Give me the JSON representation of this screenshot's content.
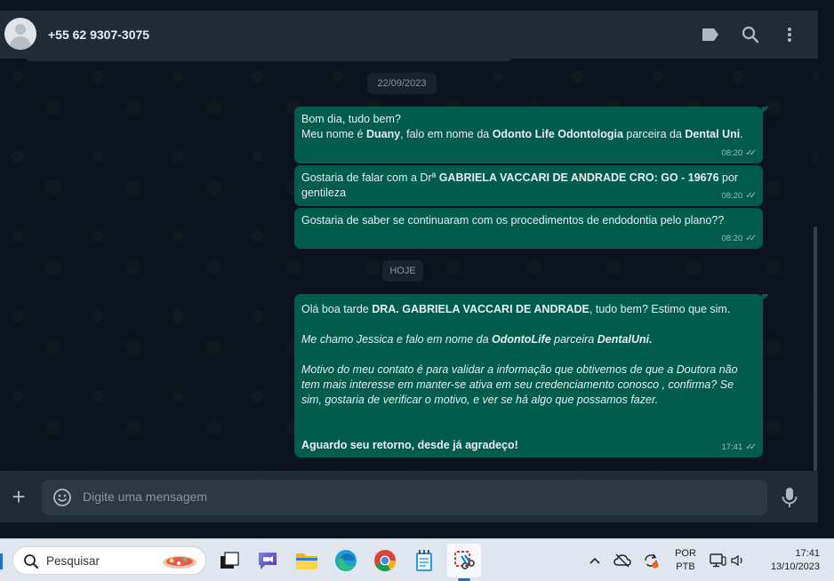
{
  "header": {
    "contact_name": "+55 62 9307-3075",
    "icons": [
      "label-icon",
      "search-icon",
      "menu-icon"
    ]
  },
  "chat": {
    "date_chips": [
      "22/09/2023",
      "HOJE"
    ],
    "messages": [
      {
        "line1": "Bom dia, tudo bem?",
        "line2_pre": "Meu nome é ",
        "line2_b1": "Duany",
        "line2_mid": ", falo em nome da ",
        "line2_b2": "Odonto Life Odontologia",
        "line2_mid2": " parceira da ",
        "line2_b3": "Dental Uni",
        "line2_end": ".",
        "time": "08:20"
      },
      {
        "pre": "Gostaria de falar com a Drª ",
        "bold": "GABRIELA VACCARI DE ANDRADE CRO: GO - 19676",
        "post": "  por gentileza",
        "time": "08:20"
      },
      {
        "text": "Gostaria de saber se continuaram com os procedimentos de endodontia pelo plano??",
        "time": "08:20"
      },
      {
        "p1_pre": "Olá boa tarde ",
        "p1_bold": "DRA. GABRIELA VACCARI DE ANDRADE",
        "p1_post": ", tudo bem? Estimo que sim.",
        "p2_pre": "Me chamo Jessica e falo em nome da ",
        "p2_b1": "OdontoLife",
        "p2_mid": " parceira ",
        "p2_b2": "DentalUni.",
        "p3": "Motivo do meu contato é para validar a informação que obtivemos de que a Doutora não tem mais interesse em manter-se ativa em seu credenciamento conosco , confirma? Se sim, gostaria de verificar o motivo, e ver se há algo que possamos fazer.",
        "p4": "Aguardo seu retorno, desde já agradeço!",
        "time": "17:41"
      }
    ]
  },
  "compose": {
    "placeholder": "Digite uma mensagem"
  },
  "taskbar": {
    "search_placeholder": "Pesquisar",
    "lang_line1": "POR",
    "lang_line2": "PTB",
    "time": "17:41",
    "date": "13/10/2023"
  },
  "colors": {
    "bubble_out": "#005c4b",
    "header_bg": "#202c33",
    "chat_bg": "#0b141a"
  }
}
